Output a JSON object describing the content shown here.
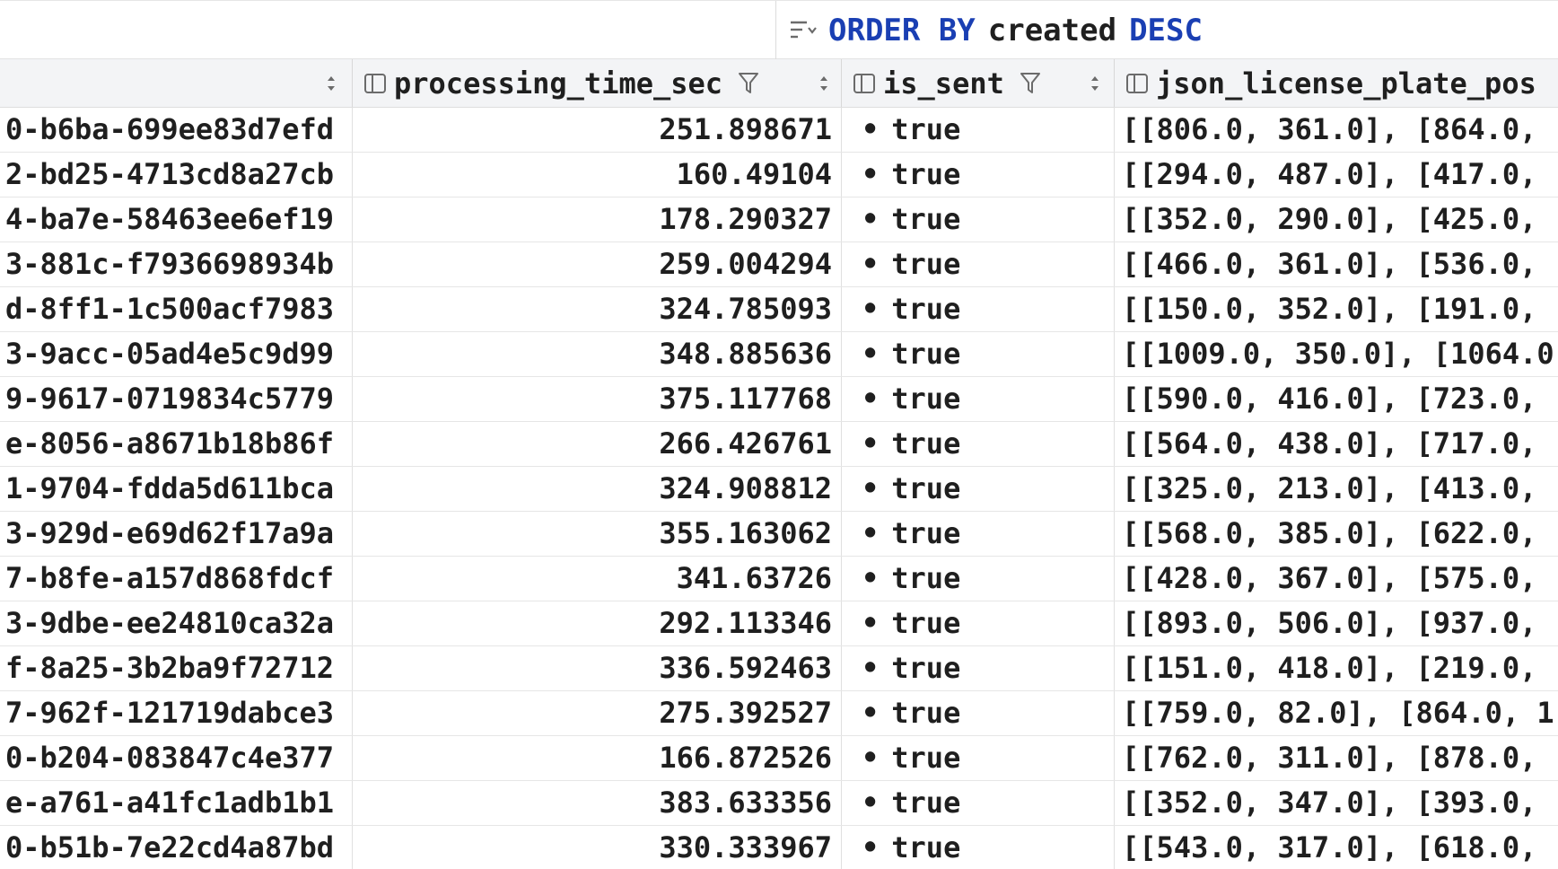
{
  "order_bar": {
    "icon": "sort-lines-icon",
    "keyword_order": "ORDER BY",
    "column": "created",
    "keyword_dir": "DESC"
  },
  "columns": [
    {
      "name": "",
      "icon": "sort-arrows-icon"
    },
    {
      "name": "processing_time_sec",
      "icon": "column-icon"
    },
    {
      "name": "is_sent",
      "icon": "column-icon"
    },
    {
      "name": "json_license_plate_pos",
      "icon": "column-icon"
    }
  ],
  "rows": [
    {
      "id": "0-b6ba-699ee83d7efd",
      "time": "251.898671",
      "sent": "true",
      "json": "[[806.0, 361.0], [864.0,"
    },
    {
      "id": "2-bd25-4713cd8a27cb",
      "time": "160.49104",
      "sent": "true",
      "json": "[[294.0, 487.0], [417.0,"
    },
    {
      "id": "4-ba7e-58463ee6ef19",
      "time": "178.290327",
      "sent": "true",
      "json": "[[352.0, 290.0], [425.0,"
    },
    {
      "id": "3-881c-f7936698934b",
      "time": "259.004294",
      "sent": "true",
      "json": "[[466.0, 361.0], [536.0,"
    },
    {
      "id": "d-8ff1-1c500acf7983",
      "time": "324.785093",
      "sent": "true",
      "json": "[[150.0, 352.0], [191.0,"
    },
    {
      "id": "3-9acc-05ad4e5c9d99",
      "time": "348.885636",
      "sent": "true",
      "json": "[[1009.0, 350.0], [1064.0"
    },
    {
      "id": "9-9617-0719834c5779",
      "time": "375.117768",
      "sent": "true",
      "json": "[[590.0, 416.0], [723.0,"
    },
    {
      "id": "e-8056-a8671b18b86f",
      "time": "266.426761",
      "sent": "true",
      "json": "[[564.0, 438.0], [717.0,"
    },
    {
      "id": "1-9704-fdda5d611bca",
      "time": "324.908812",
      "sent": "true",
      "json": "[[325.0, 213.0], [413.0,"
    },
    {
      "id": "3-929d-e69d62f17a9a",
      "time": "355.163062",
      "sent": "true",
      "json": "[[568.0, 385.0], [622.0,"
    },
    {
      "id": "7-b8fe-a157d868fdcf",
      "time": "341.63726",
      "sent": "true",
      "json": "[[428.0, 367.0], [575.0,"
    },
    {
      "id": "3-9dbe-ee24810ca32a",
      "time": "292.113346",
      "sent": "true",
      "json": "[[893.0, 506.0], [937.0,"
    },
    {
      "id": "f-8a25-3b2ba9f72712",
      "time": "336.592463",
      "sent": "true",
      "json": "[[151.0, 418.0], [219.0,"
    },
    {
      "id": "7-962f-121719dabce3",
      "time": "275.392527",
      "sent": "true",
      "json": "[[759.0, 82.0], [864.0, 1"
    },
    {
      "id": "0-b204-083847c4e377",
      "time": "166.872526",
      "sent": "true",
      "json": "[[762.0, 311.0], [878.0,"
    },
    {
      "id": "e-a761-a41fc1adb1b1",
      "time": "383.633356",
      "sent": "true",
      "json": "[[352.0, 347.0], [393.0,"
    },
    {
      "id": "0-b51b-7e22cd4a87bd",
      "time": "330.333967",
      "sent": "true",
      "json": "[[543.0, 317.0], [618.0,"
    }
  ],
  "bullet": "•"
}
